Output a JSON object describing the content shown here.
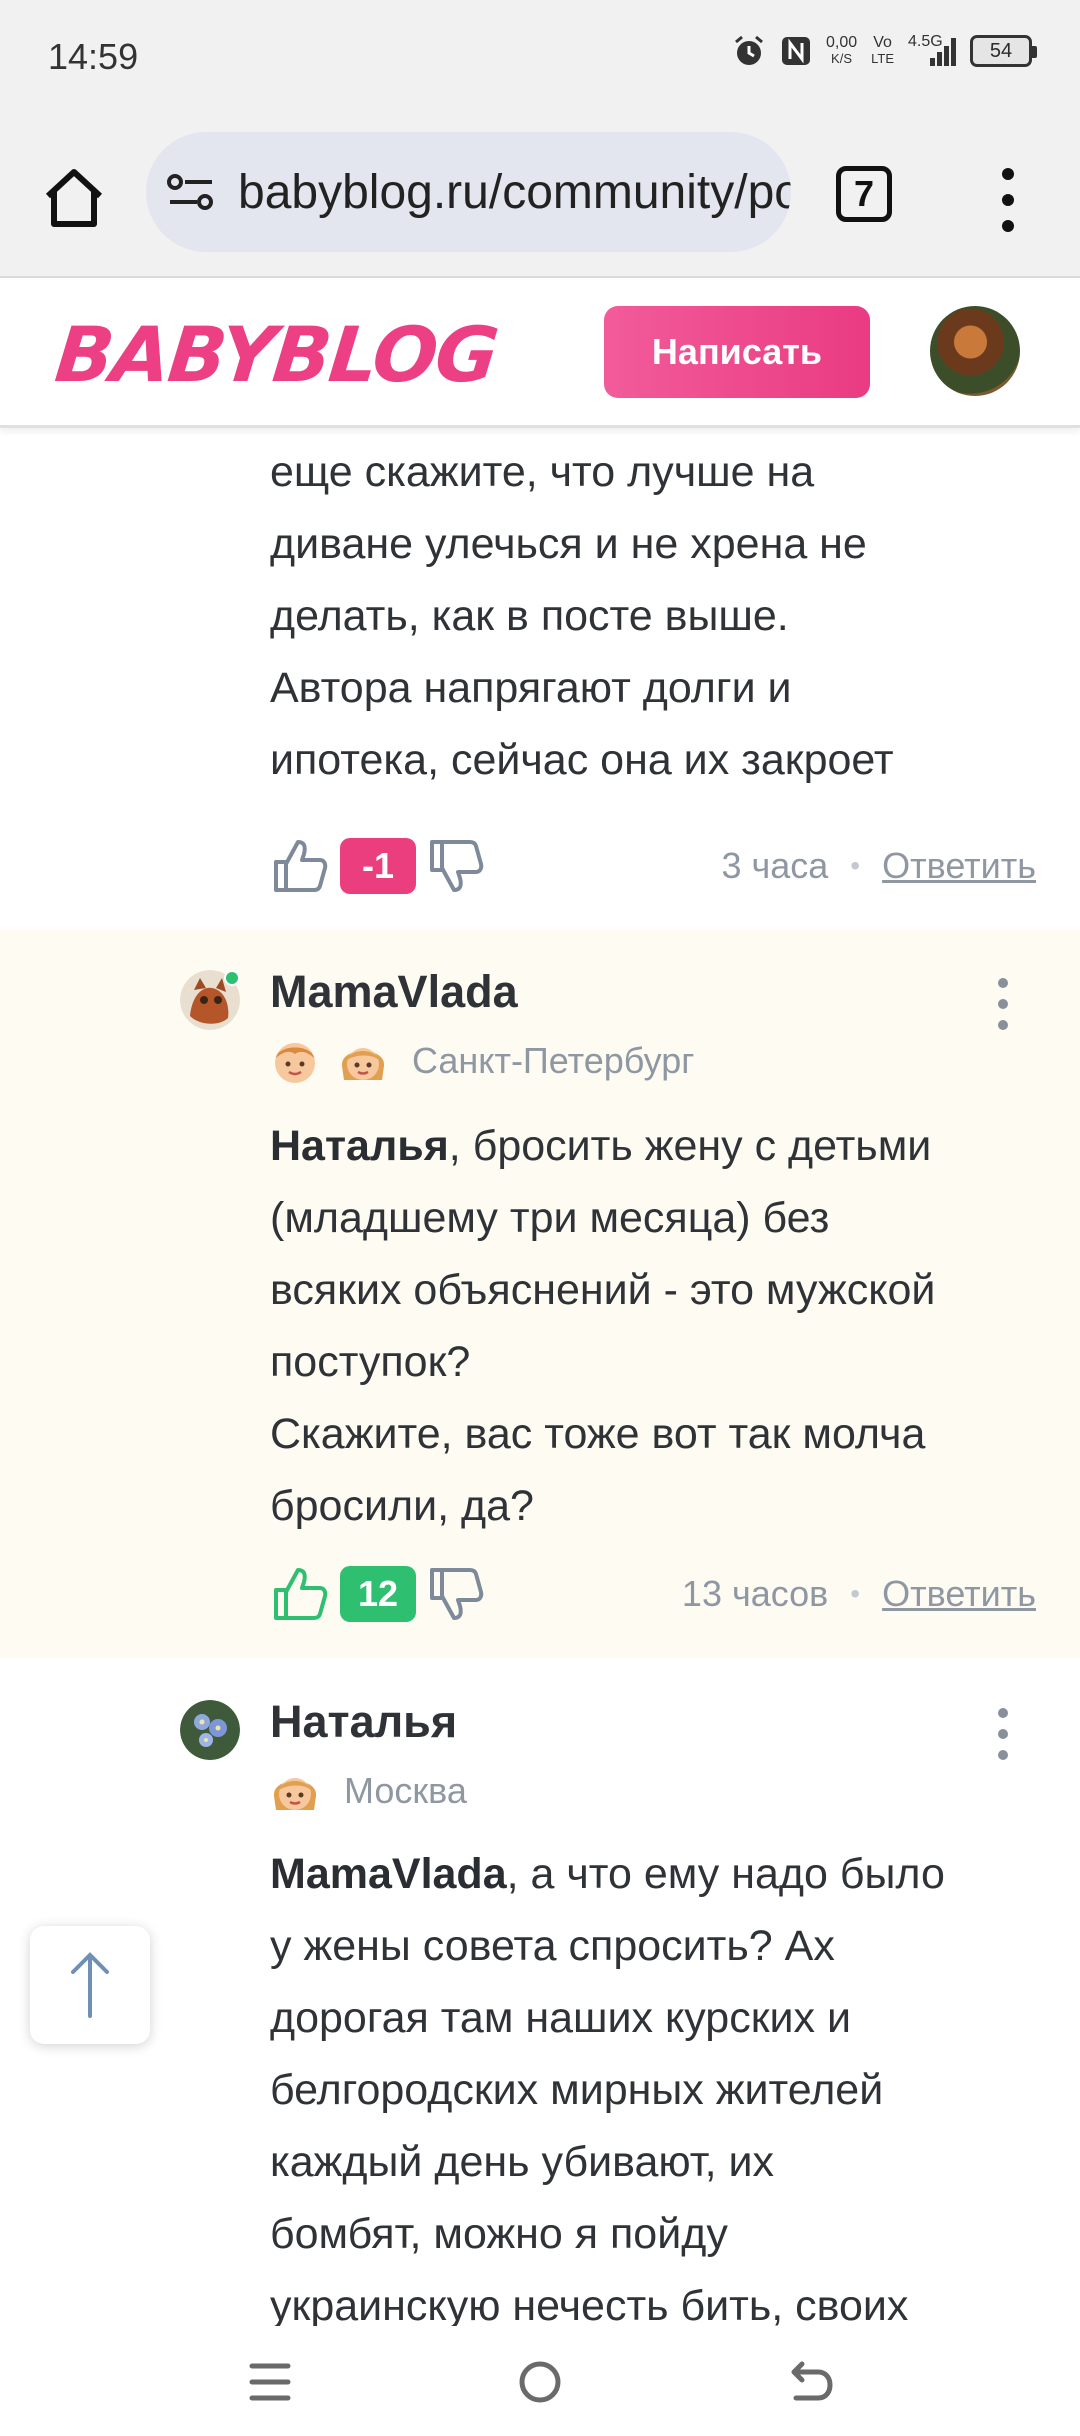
{
  "status_bar": {
    "time": "14:59",
    "net_speed_value": "0,00",
    "net_speed_unit": "K/S",
    "vo_label": "Vo",
    "lte_label": "LTE",
    "network_label": "4.5G",
    "battery": "54"
  },
  "browser": {
    "url": "babyblog.ru/community/post",
    "tab_count": "7"
  },
  "site": {
    "logo_text": "BABYBLOG",
    "write_button": "Написать",
    "accent_color": "#ea3b82"
  },
  "previous_comment": {
    "lines": [
      "еще скажите, что лучше на",
      "диване улечься и не хрена не",
      "делать, как в посте выше.",
      "Автора напрягают долги и",
      "ипотека, сейчас она их закроет"
    ],
    "score": "-1",
    "time": "3 часа",
    "reply": "Ответить"
  },
  "comments": [
    {
      "author": "MamaVlada",
      "city": "Санкт-Петербург",
      "mention": "Наталья",
      "body": [
        ", бросить жену с детьми",
        "(младшему три месяца) без",
        "всяких объяснений - это мужской",
        "поступок?",
        "Скажите, вас тоже вот так молча",
        "бросили, да?"
      ],
      "score": "12",
      "time": "13 часов",
      "reply": "Ответить"
    },
    {
      "author": "Наталья",
      "city": "Москва",
      "mention": "MamaVlada",
      "body": [
        ", а что ему надо было",
        "у жены совета спросить? Ах",
        "дорогая там наших курских и",
        "белгородских мирных жителей",
        "каждый день убивают, их",
        "бомбят, можно я пойду",
        "украинскую нечесть бить, своих"
      ]
    }
  ]
}
